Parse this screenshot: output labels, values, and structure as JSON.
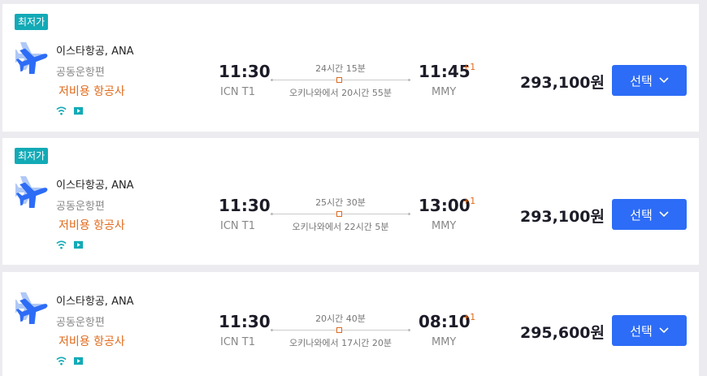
{
  "flights": [
    {
      "badge": "최저가",
      "airline": "이스타항공, ANA",
      "codeshare": "공동운항편",
      "budget": "저비용 항공사",
      "dep_time": "11:30",
      "dep_airport": "ICN T1",
      "duration": "24시간 15분",
      "layover": "오키나와에서 20시간 55분",
      "arr_time": "11:45",
      "day_offset": "+1",
      "arr_airport": "MMY",
      "price": "293,100원",
      "select_label": "선택"
    },
    {
      "badge": "최저가",
      "airline": "이스타항공, ANA",
      "codeshare": "공동운항편",
      "budget": "저비용 항공사",
      "dep_time": "11:30",
      "dep_airport": "ICN T1",
      "duration": "25시간 30분",
      "layover": "오키나와에서 22시간 5분",
      "arr_time": "13:00",
      "day_offset": "+1",
      "arr_airport": "MMY",
      "price": "293,100원",
      "select_label": "선택"
    },
    {
      "airline": "이스타항공, ANA",
      "codeshare": "공동운항편",
      "budget": "저비용 항공사",
      "dep_time": "11:30",
      "dep_airport": "ICN T1",
      "duration": "20시간 40분",
      "layover": "오키나와에서 17시간 20분",
      "arr_time": "08:10",
      "day_offset": "+1",
      "arr_airport": "MMY",
      "price": "295,600원",
      "select_label": "선택"
    }
  ],
  "colors": {
    "badge": "#13aab6",
    "budget": "#e0691a",
    "button": "#2d6cf6",
    "amenity": "#13aab6"
  },
  "icons": [
    "airplane-logo-icon",
    "wifi-icon",
    "entertainment-icon",
    "chevron-down-icon"
  ]
}
